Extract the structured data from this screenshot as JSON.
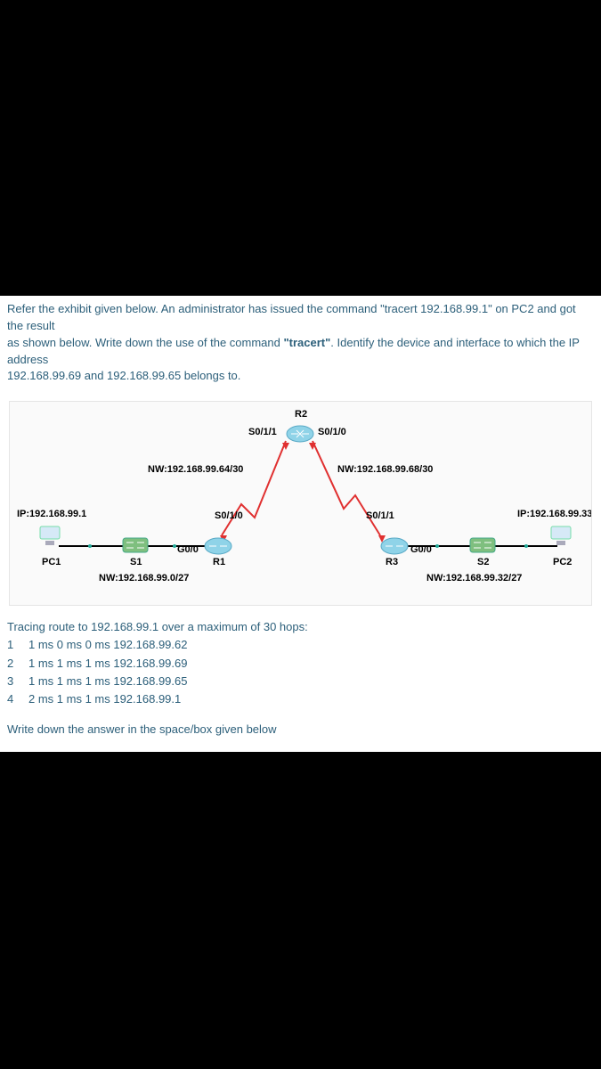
{
  "question": {
    "line1": "Refer the exhibit given below. An administrator has issued the command \"tracert 192.168.99.1\" on PC2 and got the result",
    "line2": "as shown below. Write down the use of the command ",
    "bold": "\"tracert\"",
    "line2b": ". Identify the device and interface to which the IP address",
    "line3": "192.168.99.69 and 192.168.99.65 belongs to."
  },
  "diagram": {
    "R2": "R2",
    "s011_r2": "S0/1/1",
    "s010_r2": "S0/1/0",
    "nw_left_top": "NW:192.168.99.64/30",
    "nw_right_top": "NW:192.168.99.68/30",
    "ip_pc1": "IP:192.168.99.1",
    "ip_pc2": "IP:192.168.99.33",
    "s010_r1": "S0/1/0",
    "s011_r3": "S0/1/1",
    "g00_r1": "G0/0",
    "g00_r3": "G0/0",
    "PC1": "PC1",
    "PC2": "PC2",
    "S1": "S1",
    "S2": "S2",
    "R1": "R1",
    "R3": "R3",
    "nw_left_bottom": "NW:192.168.99.0/27",
    "nw_right_bottom": "NW:192.168.99.32/27"
  },
  "tracert": {
    "header": "Tracing route to 192.168.99.1 over a maximum of 30 hops:",
    "hops": [
      {
        "n": "1",
        "txt": "1 ms 0 ms 0 ms 192.168.99.62"
      },
      {
        "n": "2",
        "txt": "1 ms 1 ms 1 ms 192.168.99.69"
      },
      {
        "n": "3",
        "txt": "1 ms 1 ms 1 ms 192.168.99.65"
      },
      {
        "n": "4",
        "txt": "2 ms 1 ms 1 ms 192.168.99.1"
      }
    ]
  },
  "answer_prompt": "Write down the answer in the space/box given below",
  "chart_data": {
    "type": "network-diagram",
    "devices": [
      {
        "name": "PC1",
        "type": "pc",
        "ip": "192.168.99.1"
      },
      {
        "name": "S1",
        "type": "switch"
      },
      {
        "name": "R1",
        "type": "router",
        "interfaces": [
          {
            "name": "G0/0"
          },
          {
            "name": "S0/1/0"
          }
        ]
      },
      {
        "name": "R2",
        "type": "router",
        "interfaces": [
          {
            "name": "S0/1/1"
          },
          {
            "name": "S0/1/0"
          }
        ]
      },
      {
        "name": "R3",
        "type": "router",
        "interfaces": [
          {
            "name": "S0/1/1"
          },
          {
            "name": "G0/0"
          }
        ]
      },
      {
        "name": "S2",
        "type": "switch"
      },
      {
        "name": "PC2",
        "type": "pc",
        "ip": "192.168.99.33"
      }
    ],
    "links": [
      {
        "from": "PC1",
        "to": "S1",
        "network": "192.168.99.0/27"
      },
      {
        "from": "S1",
        "to": "R1:G0/0",
        "network": "192.168.99.0/27"
      },
      {
        "from": "R1:S0/1/0",
        "to": "R2:S0/1/1",
        "network": "192.168.99.64/30"
      },
      {
        "from": "R2:S0/1/0",
        "to": "R3:S0/1/1",
        "network": "192.168.99.68/30"
      },
      {
        "from": "R3:G0/0",
        "to": "S2",
        "network": "192.168.99.32/27"
      },
      {
        "from": "S2",
        "to": "PC2",
        "network": "192.168.99.32/27"
      }
    ],
    "tracert_result": [
      {
        "hop": 1,
        "times_ms": [
          1,
          0,
          0
        ],
        "ip": "192.168.99.62"
      },
      {
        "hop": 2,
        "times_ms": [
          1,
          1,
          1
        ],
        "ip": "192.168.99.69"
      },
      {
        "hop": 3,
        "times_ms": [
          1,
          1,
          1
        ],
        "ip": "192.168.99.65"
      },
      {
        "hop": 4,
        "times_ms": [
          2,
          1,
          1
        ],
        "ip": "192.168.99.1"
      }
    ]
  }
}
